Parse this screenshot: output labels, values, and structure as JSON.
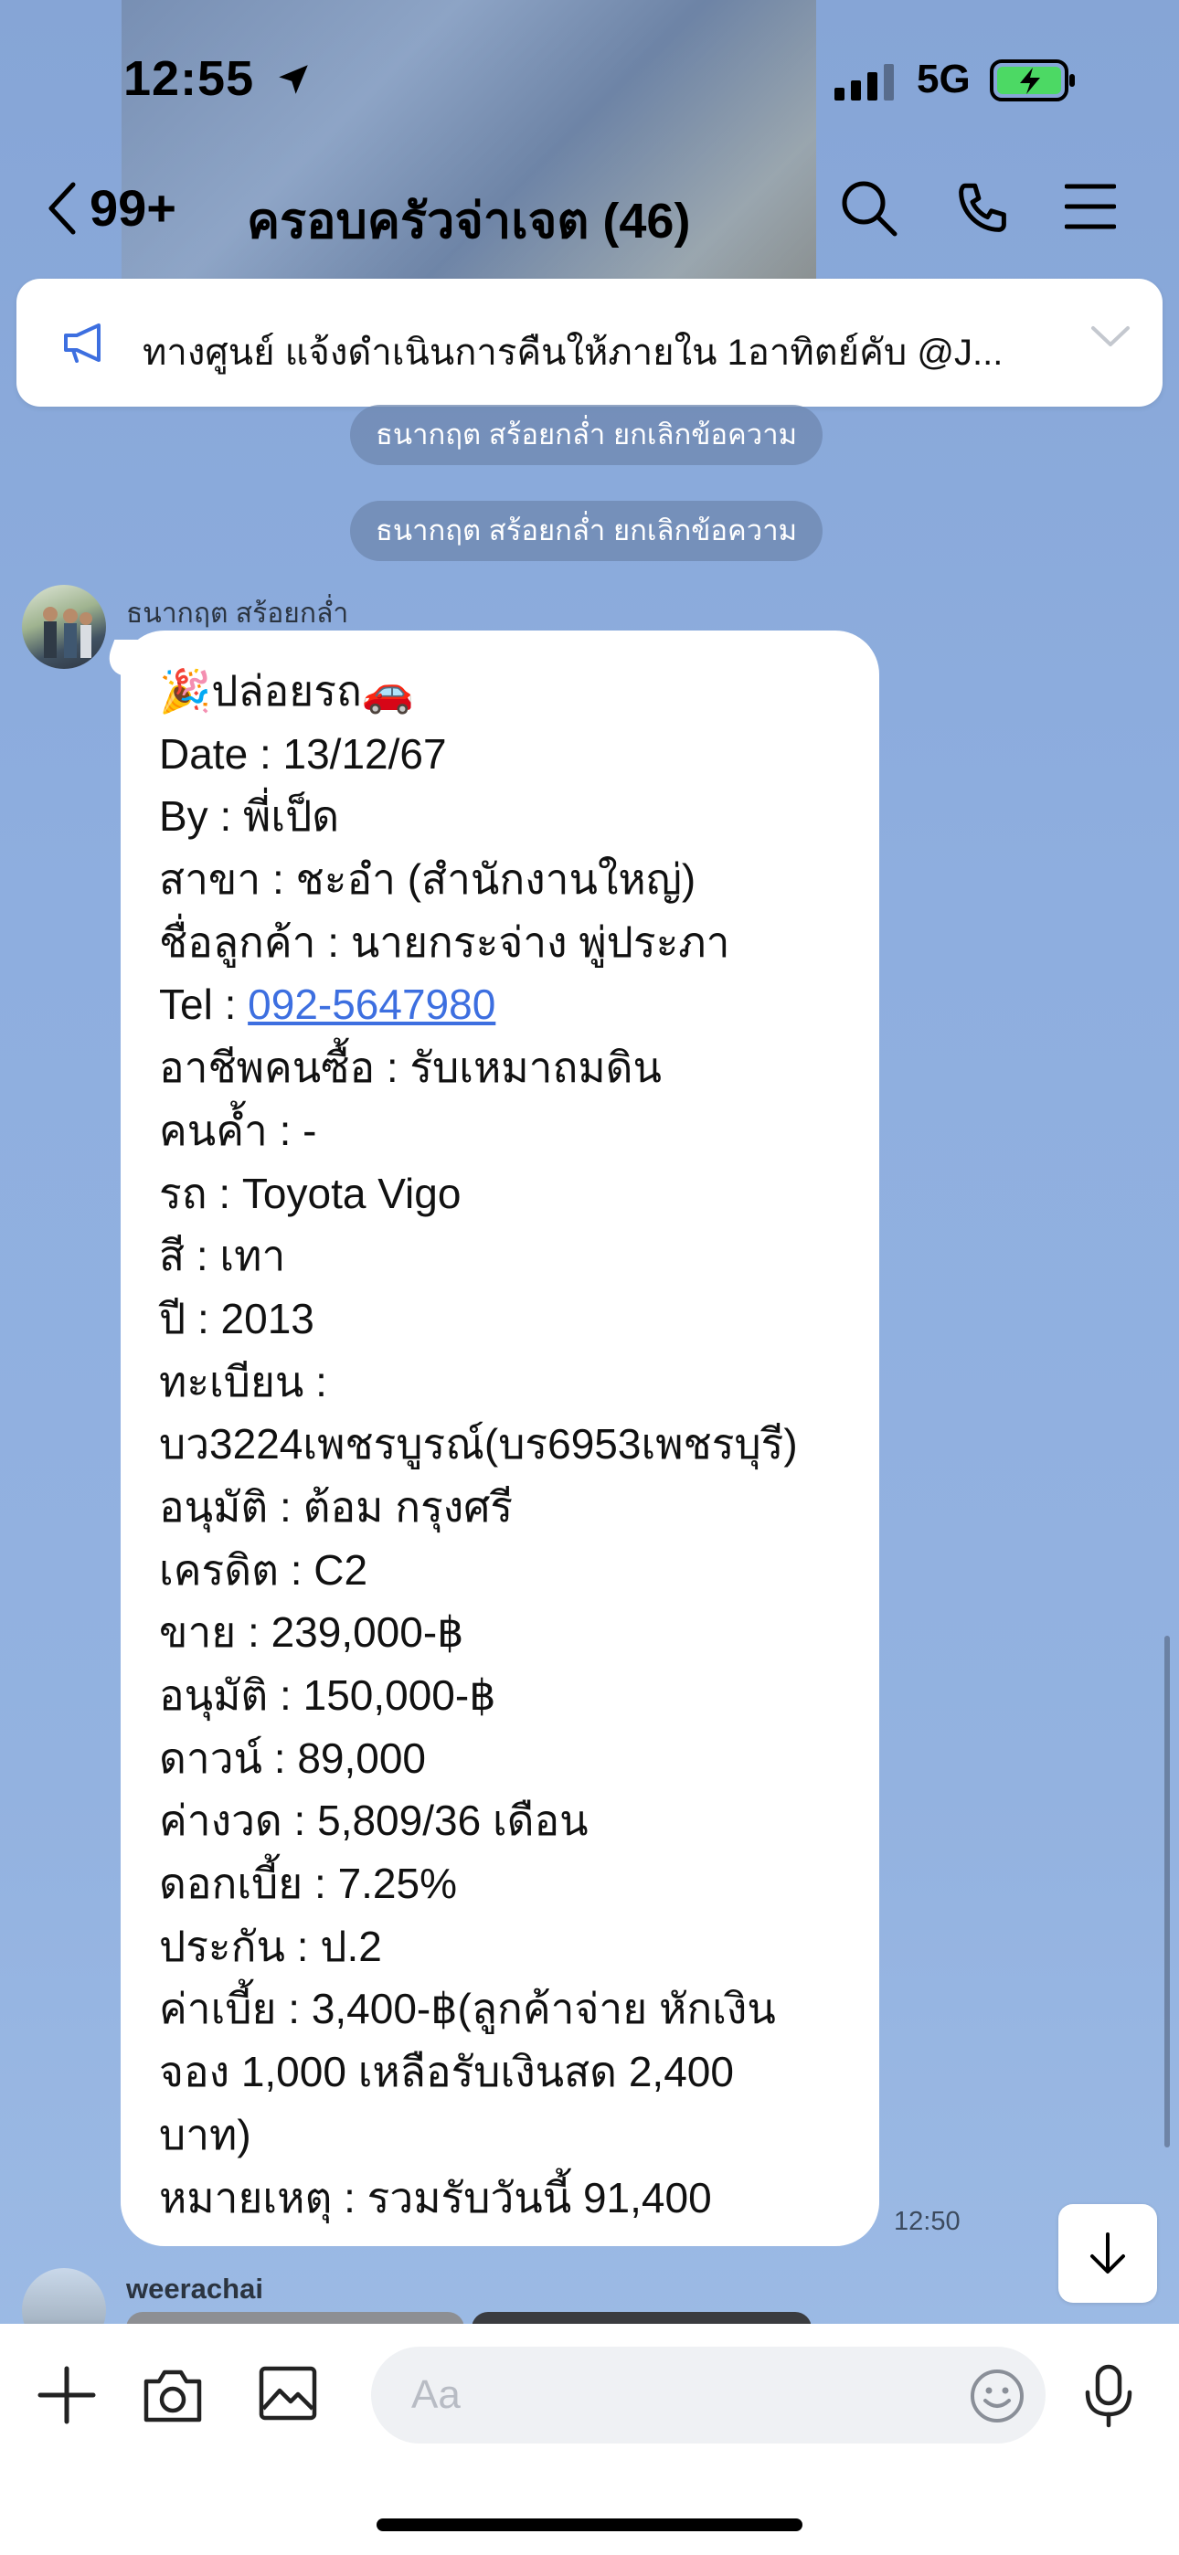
{
  "status_bar": {
    "time": "12:55",
    "network": "5G"
  },
  "header": {
    "back_count": "99+",
    "title": "ครอบครัวจ่าเจต (46)"
  },
  "announcement": {
    "text": "ทางศูนย์ แจ้งดำเนินการคืนให้ภายใน 1อาทิตย์คับ @J..."
  },
  "system_messages": [
    "ธนากฤต สร้อยกล่ำ ยกเลิกข้อความ",
    "ธนากฤต สร้อยกล่ำ ยกเลิกข้อความ"
  ],
  "message": {
    "sender": "ธนากฤต สร้อยกล่ำ",
    "time": "12:50",
    "lines": [
      "🎉ปล่อยรถ🚗",
      "Date : 13/12/67",
      "By : พี่เป็ด",
      "สาขา : ชะอำ (สำนักงานใหญ่)",
      "ชื่อลูกค้า : นายกระจ่าง พู่ประภา",
      "Tel : ",
      "อาชีพคนซื้อ : รับเหมาถมดิน",
      "คนค้ำ : -",
      "รถ : Toyota Vigo",
      "สี : เทา",
      "ปี : 2013",
      "ทะเบียน :",
      "บว3224เพชรบูรณ์(บร6953เพชรบุรี)",
      "อนุมัติ : ต้อม กรุงศรี",
      "เครดิต : C2",
      "ขาย : 239,000-฿",
      "อนุมัติ : 150,000-฿",
      "ดาวน์ : 89,000",
      "ค่างวด : 5,809/36 เดือน",
      "ดอกเบี้ย : 7.25%",
      "ประกัน : ป.2",
      "ค่าเบี้ย : 3,400-฿(ลูกค้าจ่าย หักเงิน",
      "จอง 1,000 เหลือรับเงินสด 2,400",
      "บาท)",
      "หมายเหตุ : รวมรับวันนี้ 91,400"
    ],
    "phone": "092-5647980"
  },
  "next_message": {
    "sender": "weerachai"
  },
  "input": {
    "placeholder": "Aa"
  },
  "colors": {
    "background": "#8eaedf",
    "link": "#3d6fe0",
    "battery": "#4cd964"
  }
}
